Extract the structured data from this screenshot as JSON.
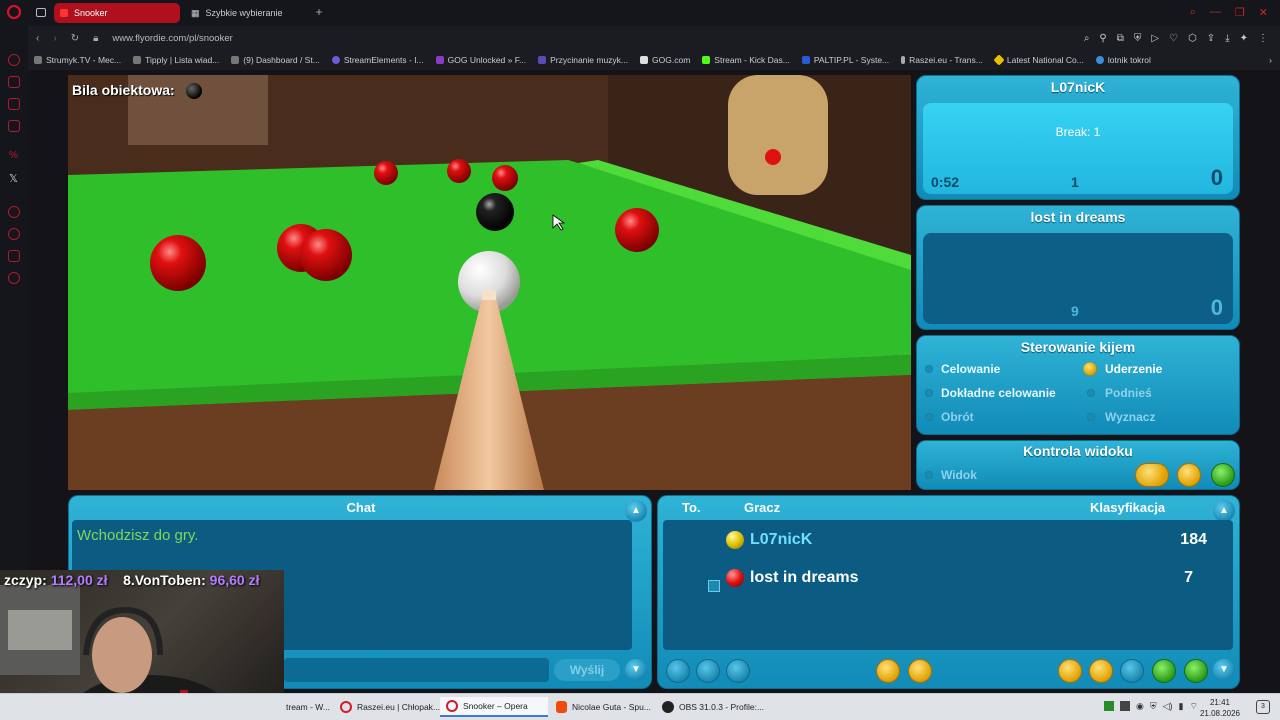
{
  "browser": {
    "tabs": [
      {
        "label": "Snooker",
        "active": true
      },
      {
        "label": "Szybkie wybieranie",
        "active": false
      }
    ],
    "new_tab": "+",
    "url": "www.flyordie.com/pl/snooker",
    "bookmarks": [
      "Strumyk.TV - Mec...",
      "Tipply | Lista wiad...",
      "(9) Dashboard / St...",
      "StreamElements - I...",
      "GOG Unlocked » F...",
      "Przycinanie muzyk...",
      "GOG.com",
      "Stream - Kick Das...",
      "PALTIP.PL - Syste...",
      "Raszei.eu - Trans...",
      "Latest National Co...",
      "lotnik tokrol"
    ],
    "accent": "#b0101e"
  },
  "game": {
    "object_ball_label": "Bila obiektowa:",
    "player1": {
      "name": "L07nicK",
      "break_label": "Break: 1",
      "time": "0:52",
      "balls": "1",
      "score": "0"
    },
    "player2": {
      "name": "lost in dreams",
      "balls": "9",
      "score": "0"
    },
    "cue_control": {
      "title": "Sterowanie kijem",
      "options": [
        {
          "label": "Celowanie",
          "selected": false
        },
        {
          "label": "Uderzenie",
          "selected": true
        },
        {
          "label": "Dokładne celowanie",
          "selected": false
        },
        {
          "label": "Podnieś",
          "selected": false
        },
        {
          "label": "Obrót",
          "selected": false
        },
        {
          "label": "Wyznacz",
          "selected": false
        }
      ]
    },
    "view_control": {
      "title": "Kontrola widoku",
      "option": "Widok"
    },
    "chat": {
      "title": "Chat",
      "message": "Wchodzisz do gry.",
      "send_label": "Wyślij"
    },
    "ranking": {
      "col_turn": "To.",
      "col_player": "Gracz",
      "col_rank": "Klasyfikacja",
      "rows": [
        {
          "name": "L07nicK",
          "rating": "184",
          "ball": "yellow",
          "highlight": true
        },
        {
          "name": "lost in dreams",
          "rating": "7",
          "ball": "red",
          "highlight": false
        }
      ]
    }
  },
  "overlay": {
    "donor1_name": "zczyp:",
    "donor1_amount": "112,00 zł",
    "donor2_name": "8.VonToben:",
    "donor2_amount": "96,60 zł"
  },
  "taskbar": {
    "items": [
      "tream - W...",
      "Raszei.eu | Chłopak...",
      "Snooker – Opera",
      "Nicolae Guta - Spu...",
      "OBS 31.0.3 - Profile:..."
    ],
    "time": "21:41",
    "date": "21.08.2026",
    "notifications": "3"
  }
}
